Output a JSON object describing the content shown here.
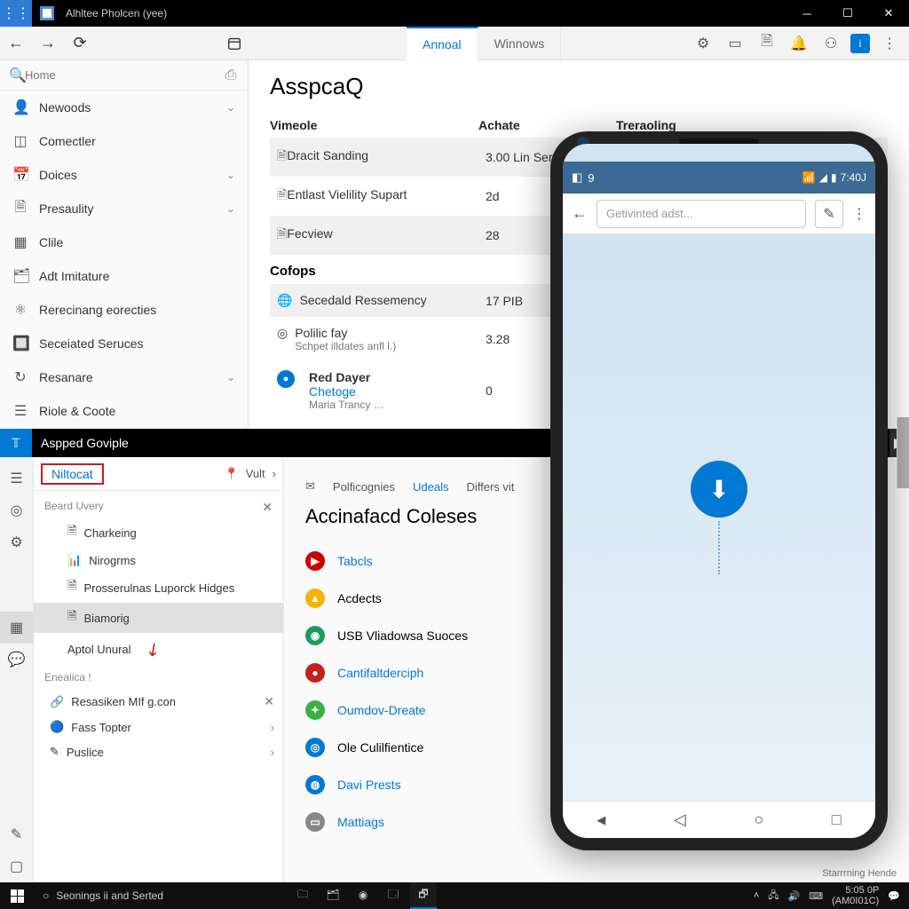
{
  "titlebar": {
    "title": "Alhltee Pholcen (yee)"
  },
  "upper_toolbar": {
    "tabs": [
      {
        "label": "Annoal",
        "active": true
      },
      {
        "label": "Winnows",
        "active": false
      }
    ],
    "user_badge": "i"
  },
  "search": {
    "placeholder": "Home"
  },
  "upper_sidebar": [
    {
      "label": "Newoods",
      "icon": "person",
      "chevron": true
    },
    {
      "label": "Comectler",
      "icon": "square",
      "chevron": false
    },
    {
      "label": "Doices",
      "icon": "calendar",
      "chevron": true
    },
    {
      "label": "Presaulity",
      "icon": "doc",
      "chevron": true
    },
    {
      "label": "Clile",
      "icon": "layout",
      "chevron": false
    },
    {
      "label": "Adt Imitature",
      "icon": "folder",
      "chevron": false
    },
    {
      "label": "Rerecinang eorecties",
      "icon": "grid",
      "chevron": false
    },
    {
      "label": "Seceiated Seruces",
      "icon": "apps",
      "chevron": false
    },
    {
      "label": "Resanare",
      "icon": "refresh",
      "chevron": true
    },
    {
      "label": "Riole & Coote",
      "icon": "list",
      "chevron": false
    }
  ],
  "upper_content": {
    "heading": "AsspcaQ",
    "cols": [
      "Vimeole",
      "Achate",
      "Treraoling"
    ],
    "rows": [
      {
        "name": "Dracit Sanding",
        "achate": "3.00 Lin Serecec",
        "sel": true
      },
      {
        "name": "Entlast Vielility Supart",
        "achate": "2d",
        "sel": false
      },
      {
        "name": "Fecview",
        "achate": "28",
        "sel": true
      }
    ],
    "subhead": "Cofops",
    "rows2": [
      {
        "name": "Secedald Ressemency",
        "achate": "17 PIB",
        "icon": "globe"
      },
      {
        "name": "Polilic fay",
        "sub": "Schpet illdates anfl l.)",
        "achate": "3.28",
        "icon": "target"
      },
      {
        "name": "Red Dayer",
        "link": "Chetoge",
        "sub2": "Maria Trancy …",
        "achate": "0",
        "icon": "badge"
      }
    ]
  },
  "lower_header": {
    "title": "Aspped Goviple"
  },
  "lower_toolbar": {
    "boxed": "Niltocat",
    "items": [
      "Vult",
      "Polficognies",
      "Udeals",
      "Differs vit"
    ]
  },
  "lower_left": {
    "section1": "Beard Uvery",
    "tree": [
      {
        "label": "Charkeing",
        "icon": "doc",
        "lvl": 2
      },
      {
        "label": "Nirogrms",
        "icon": "bars",
        "lvl": 2
      },
      {
        "label": "Prosserulnas Luporck Hidges",
        "icon": "doc",
        "lvl": 2
      },
      {
        "label": "Biamorig",
        "icon": "doc",
        "lvl": 2,
        "selected": true
      },
      {
        "label": "Aptol Unural",
        "icon": "",
        "lvl": 2,
        "arrow": true
      }
    ],
    "section2": "Enealica !",
    "tree2": [
      {
        "label": "Resasiken MIf g.con",
        "icon": "link",
        "close": true
      },
      {
        "label": "Fass Topter",
        "icon": "dot",
        "chev": true
      },
      {
        "label": "Puslice",
        "icon": "edit",
        "chev": true
      }
    ]
  },
  "lower_right": {
    "heading": "Accinafacd Coleses",
    "items": [
      {
        "label": "Tabcls",
        "color": "#cc0000",
        "link": true,
        "glyph": "▶"
      },
      {
        "label": "Acdects",
        "color": "#f4b400",
        "link": false,
        "glyph": "▲"
      },
      {
        "label": "USB Vliadowsa Suoces",
        "color": "#1a9e5c",
        "link": false,
        "glyph": "◉"
      },
      {
        "label": "Cantifaltderciph",
        "color": "#c42020",
        "link": true,
        "glyph": "●"
      },
      {
        "label": "Oumdov-Dreate",
        "color": "#3cb043",
        "link": true,
        "glyph": "✦"
      },
      {
        "label": "Ole Culilfientice",
        "color": "#0078d4",
        "link": false,
        "glyph": "◎"
      },
      {
        "label": "Davi Prests",
        "color": "#0078d4",
        "link": true,
        "glyph": "◍"
      },
      {
        "label": "Mattiags",
        "color": "#888",
        "link": true,
        "glyph": "▭"
      }
    ],
    "status": "Starrrning Hende"
  },
  "phone": {
    "status_left": "9",
    "status_time": "7:40J",
    "search_placeholder": "Getivinted adst..."
  },
  "taskbar": {
    "search": "Seonings ii and Serted",
    "time": "5:05 0P",
    "date": "(AM0I01C)"
  }
}
